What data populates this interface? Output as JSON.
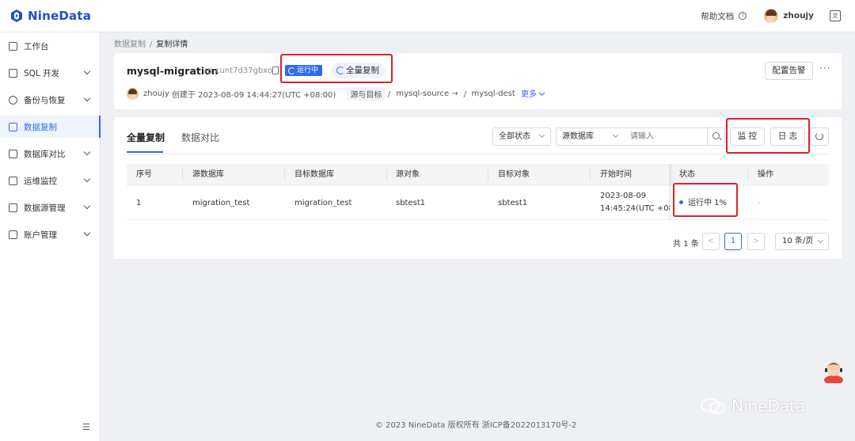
{
  "brand": {
    "name": "NineData",
    "color": "#1f4fcf",
    "accent": "#2f6bf0"
  },
  "topbar": {
    "help": "帮助文档",
    "help_icon": "question-circle-icon",
    "user": "zhoujy",
    "lang_icon": "translate-icon"
  },
  "sidebar": {
    "items": [
      {
        "label": "工作台",
        "icon": "home-icon"
      },
      {
        "label": "SQL 开发",
        "icon": "terminal-icon"
      },
      {
        "label": "备份与恢复",
        "icon": "cloud-backup-icon"
      },
      {
        "label": "数据复制",
        "icon": "copy-icon"
      },
      {
        "label": "数据库对比",
        "icon": "compare-icon"
      },
      {
        "label": "运维监控",
        "icon": "monitor-icon"
      },
      {
        "label": "数据源管理",
        "icon": "datasource-icon"
      },
      {
        "label": "账户管理",
        "icon": "account-icon"
      }
    ],
    "active": "数据复制"
  },
  "breadcrumb": {
    "parent": "数据复制",
    "current": "复制详情",
    "sep": "/"
  },
  "task": {
    "name": "mysql-migration",
    "id": "rp-cunt7d37gbxo",
    "status": "运行中",
    "type": "全量复制",
    "creator": "zhoujy",
    "created": "创建于 2023-08-09 14:44:27(UTC +08:00)",
    "src_dst_label": "源与目标",
    "source": "mysql-source",
    "dest": "mysql-dest",
    "more": "更多",
    "alarm_btn": "配置告警",
    "more_dots": "···"
  },
  "main": {
    "tabs": [
      "全量复制",
      "数据对比"
    ],
    "filter_status": "全部状态",
    "filter_db": "源数据库",
    "search_placeholder": "请输入",
    "monitor_btn": "监 控",
    "log_btn": "日 志",
    "columns": [
      "序号",
      "源数据库",
      "目标数据库",
      "源对象",
      "目标对象",
      "开始时间",
      "状态",
      "操作"
    ],
    "rows": [
      {
        "no": "1",
        "src_db": "migration_test",
        "dst_db": "migration_test",
        "src_obj": "sbtest1",
        "dst_obj": "sbtest1",
        "start_date": "2023-08-09",
        "start_time": "14:45:24(UTC +08",
        "status": "运行中 1%",
        "action": "-"
      }
    ],
    "pager": {
      "total": "共 1 条",
      "prev": "<",
      "page": "1",
      "next": ">",
      "size": "10 条/页"
    }
  },
  "footer": "© 2023 NineData 版权所有    浙ICP备2022013170号-2",
  "watermark": "NineData"
}
